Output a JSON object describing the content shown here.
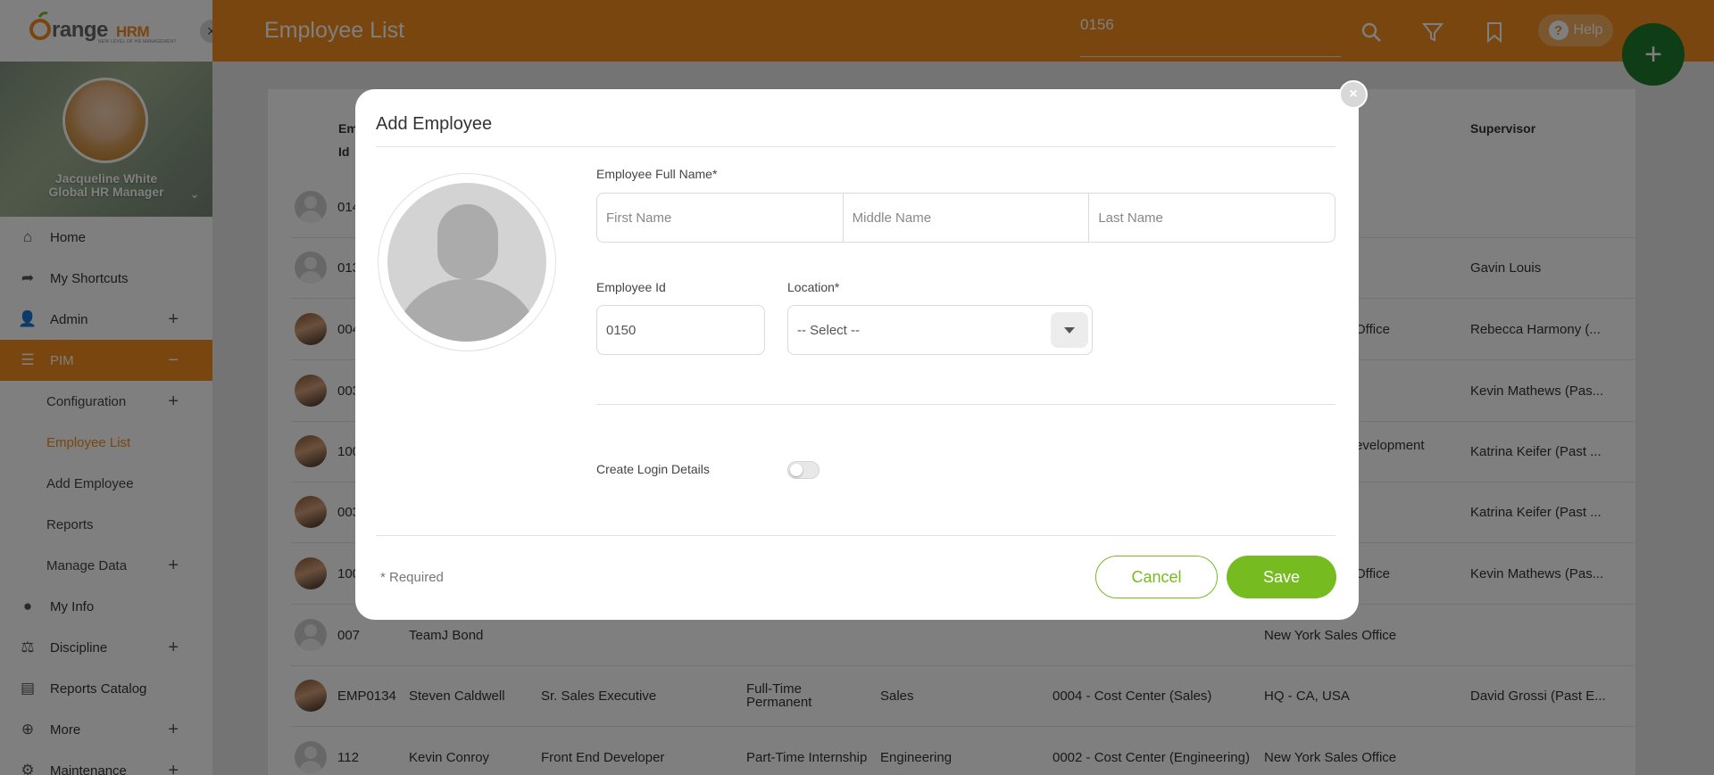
{
  "app": {
    "logo_text": "orangeHRM",
    "logo_tagline": "NEW LEVEL OF HR MANAGEMENT",
    "brand_color": "#f28c1e",
    "accent_green": "#76bc21"
  },
  "profile": {
    "name": "Jacqueline White",
    "role": "Global HR Manager"
  },
  "sidebar": {
    "items": [
      {
        "label": "Home",
        "icon": "home-icon"
      },
      {
        "label": "My Shortcuts",
        "icon": "share-icon"
      },
      {
        "label": "Admin",
        "icon": "admin-icon"
      },
      {
        "label": "PIM",
        "icon": "pim-icon"
      },
      {
        "label": "Configuration"
      },
      {
        "label": "Employee List"
      },
      {
        "label": "Add Employee"
      },
      {
        "label": "Reports"
      },
      {
        "label": "Manage Data"
      },
      {
        "label": "My Info",
        "icon": "user-icon"
      },
      {
        "label": "Discipline",
        "icon": "discipline-icon"
      },
      {
        "label": "Reports Catalog",
        "icon": "document-icon"
      },
      {
        "label": "More",
        "icon": "more-icon"
      },
      {
        "label": "Maintenance",
        "icon": "gear-icon"
      }
    ]
  },
  "header": {
    "title": "Employee List",
    "search_value": "0156",
    "help_label": "Help"
  },
  "table": {
    "headers": {
      "employee_id_1": "Em",
      "employee_id_2": "Id",
      "supervisor": "Supervisor"
    },
    "rows": [
      {
        "id": "014",
        "name": "",
        "job": "",
        "status": "",
        "sub": "",
        "cost": "",
        "location": "",
        "supervisor": ""
      },
      {
        "id": "013",
        "name": "",
        "job": "",
        "status": "",
        "sub": "",
        "cost": "",
        "location": "",
        "supervisor": "Gavin Louis"
      },
      {
        "id": "004",
        "name": "",
        "job": "",
        "status": "",
        "sub": "",
        "cost": "",
        "location": "Office",
        "supervisor": "Rebecca Harmony (..."
      },
      {
        "id": "003",
        "name": "",
        "job": "",
        "status": "",
        "sub": "",
        "cost": "",
        "location": "",
        "supervisor": "Kevin Mathews (Pas..."
      },
      {
        "id": "100",
        "name": "",
        "job": "",
        "status": "",
        "sub": "",
        "cost": "",
        "location": "evelopment",
        "supervisor": "Katrina Keifer (Past ..."
      },
      {
        "id": "003",
        "name": "",
        "job": "",
        "status": "",
        "sub": "",
        "cost": "",
        "location": "",
        "supervisor": "Katrina Keifer (Past ..."
      },
      {
        "id": "100",
        "name": "",
        "job": "",
        "status": "",
        "sub": "",
        "cost": "",
        "location": "Office",
        "supervisor": "Kevin Mathews (Pas..."
      },
      {
        "id": "007",
        "name": "TeamJ Bond",
        "job": "",
        "status": "",
        "sub": "",
        "cost": "",
        "location": "New York Sales Office",
        "supervisor": ""
      },
      {
        "id": "EMP0134",
        "name": "Steven Caldwell",
        "job": "Sr. Sales Executive",
        "status_1": "Full-Time",
        "status_2": "Permanent",
        "sub": "Sales",
        "cost": "0004 - Cost Center (Sales)",
        "location": "HQ - CA, USA",
        "supervisor": "David Grossi (Past E..."
      },
      {
        "id": "112",
        "name": "Kevin Conroy",
        "job": "Front End Developer",
        "status": "Part-Time Internship",
        "sub": "Engineering",
        "cost": "0002 - Cost Center (Engineering)",
        "location": "New York Sales Office",
        "supervisor": ""
      }
    ]
  },
  "modal": {
    "title": "Add Employee",
    "full_name_label": "Employee Full Name*",
    "first_name_placeholder": "First Name",
    "middle_name_placeholder": "Middle Name",
    "last_name_placeholder": "Last Name",
    "employee_id_label": "Employee Id",
    "employee_id_value": "0150",
    "location_label": "Location*",
    "location_value": "-- Select --",
    "create_login_label": "Create Login Details",
    "create_login_enabled": false,
    "required_note": "* Required",
    "cancel_label": "Cancel",
    "save_label": "Save"
  }
}
